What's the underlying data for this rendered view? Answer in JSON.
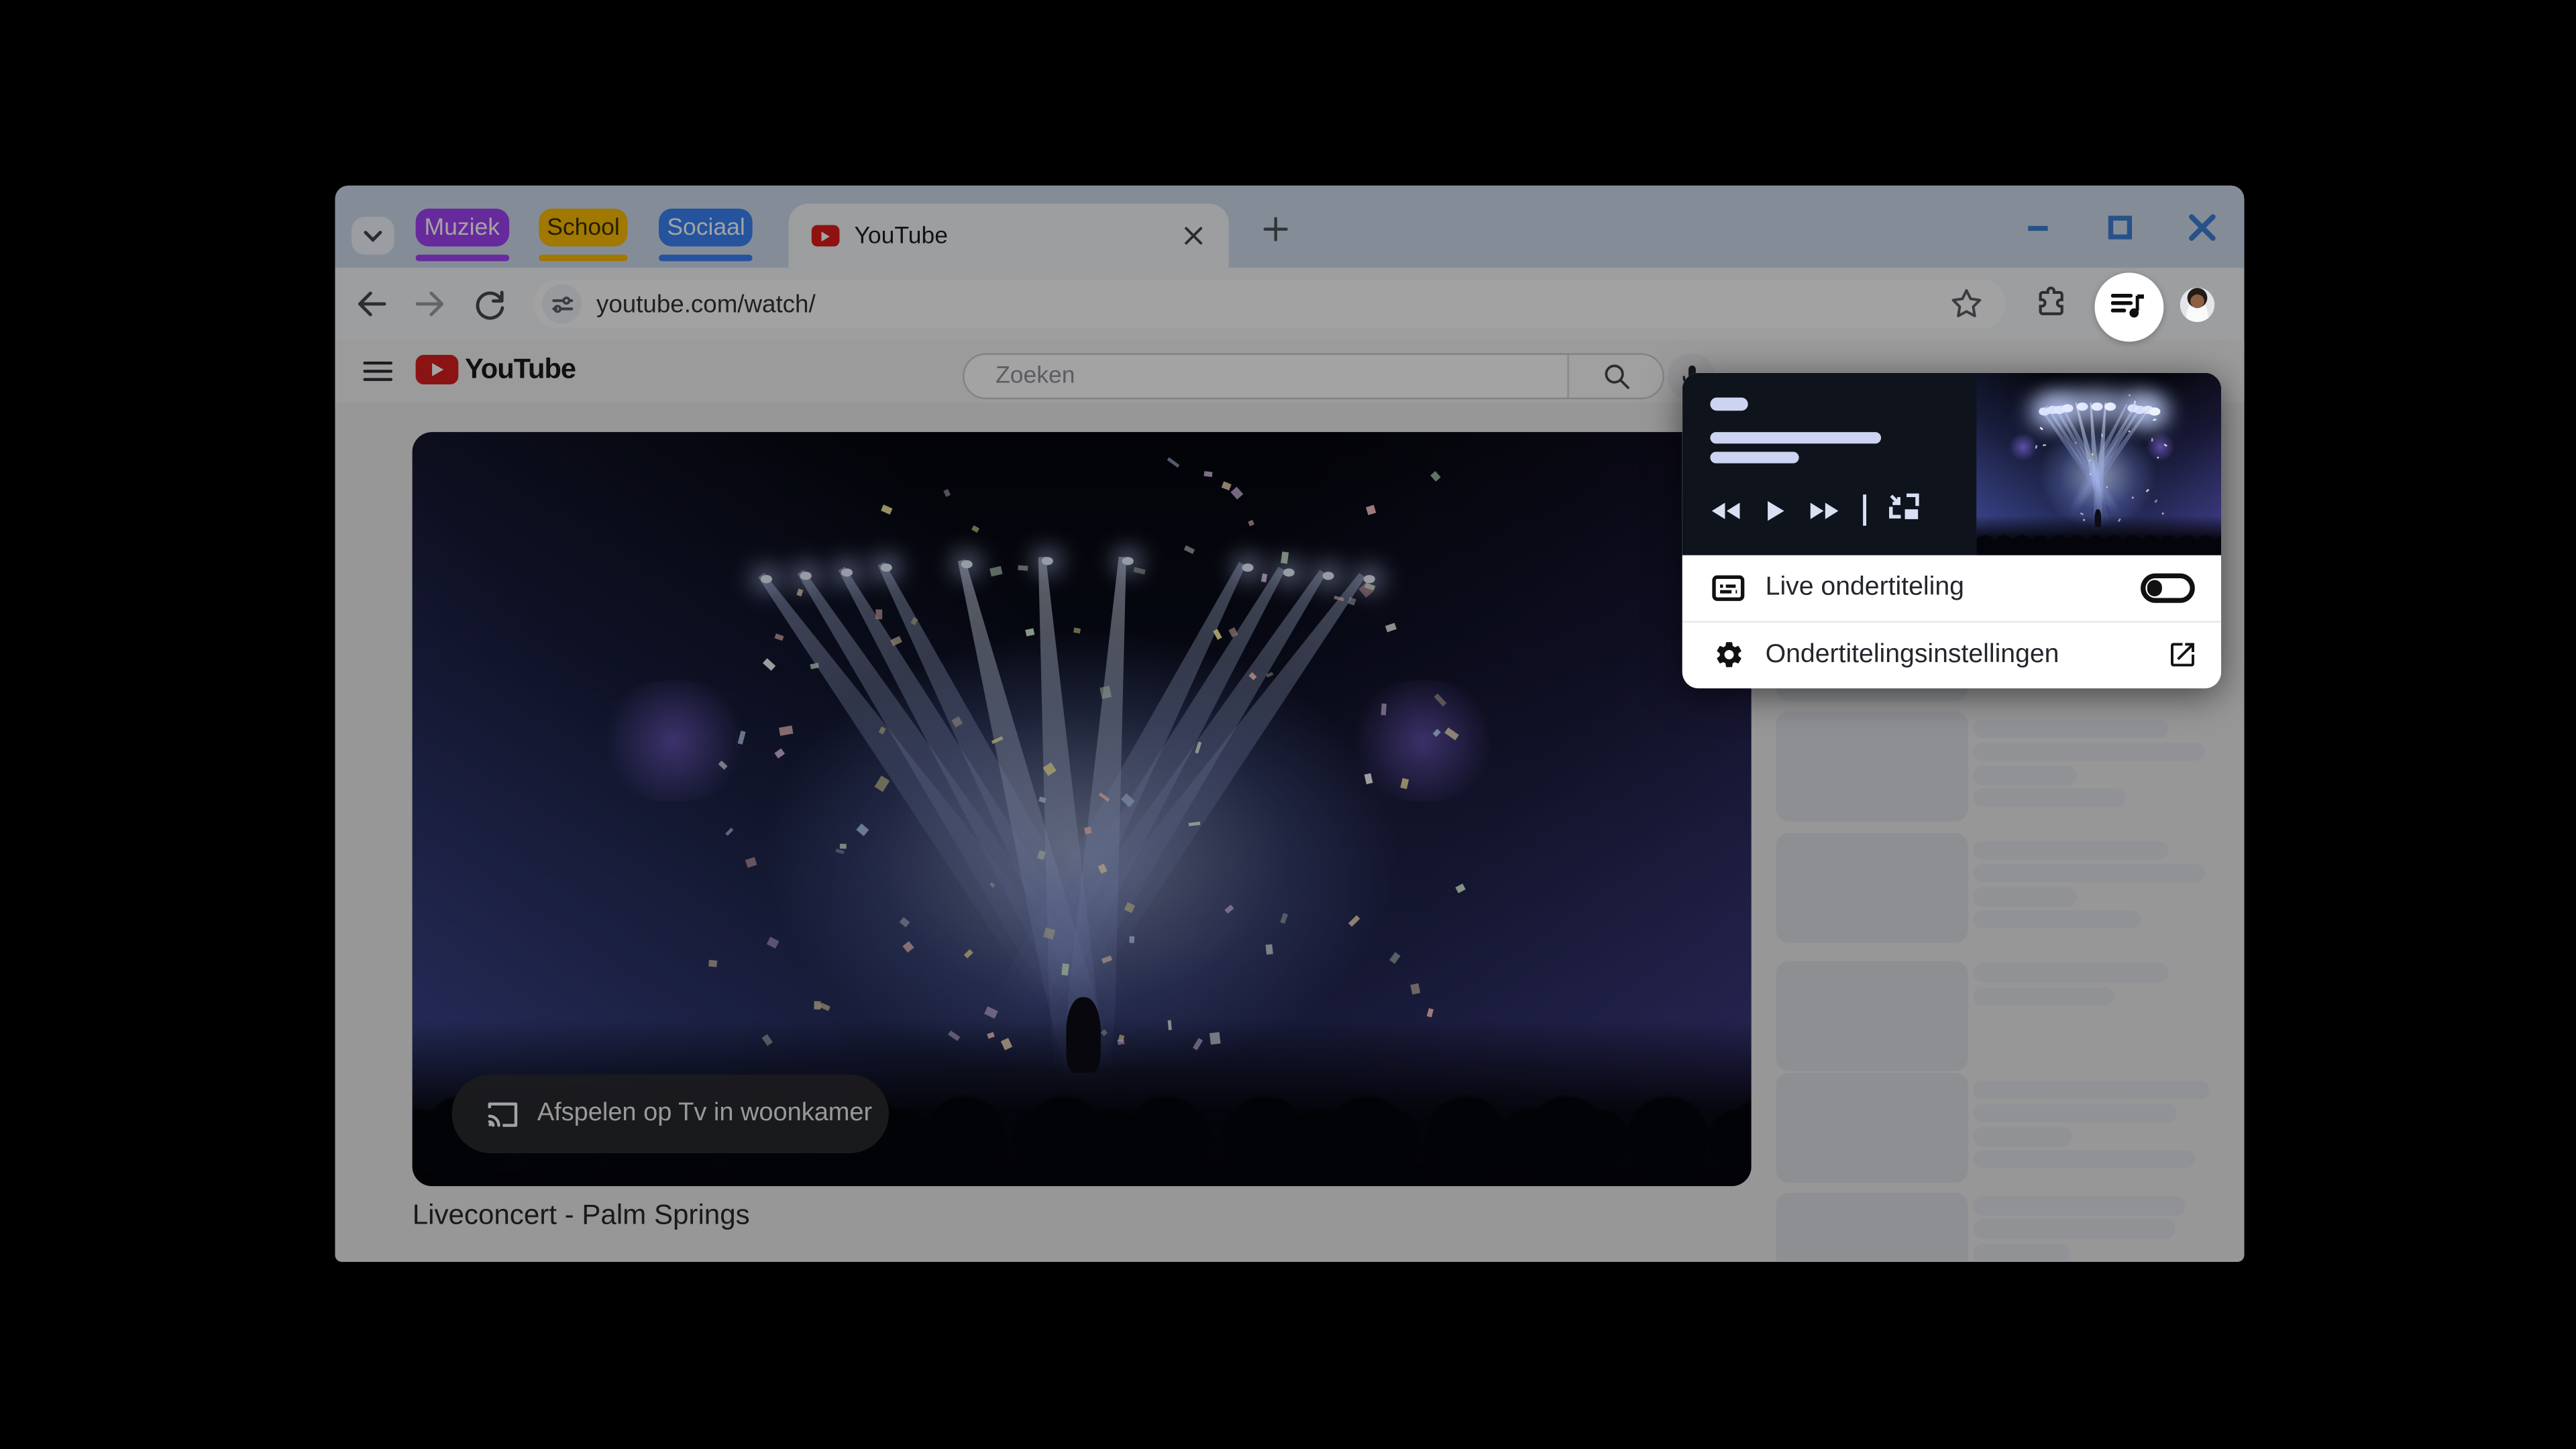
{
  "browser": {
    "tab_strip": {
      "search_button": "tab-search-chevron",
      "groups": [
        {
          "label": "Muziek",
          "color": "#a142f4",
          "text_color": "#ffffff"
        },
        {
          "label": "School",
          "color": "#fbbc04",
          "text_color": "#3c2f00"
        },
        {
          "label": "Sociaal",
          "color": "#3b82f6",
          "text_color": "#ffffff"
        }
      ],
      "active_tab": {
        "title": "YouTube"
      }
    },
    "toolbar": {
      "url": "youtube.com/watch/"
    },
    "window_controls_color": "#3f7fd6"
  },
  "youtube": {
    "search_placeholder": "Zoeken",
    "player": {
      "cast_overlay_label": "Afspelen op Tv in woonkamer"
    },
    "video_title": "Liveconcert - Palm Springs"
  },
  "media_popup": {
    "rows": [
      {
        "label": "Live ondertiteling",
        "control": "toggle",
        "state": "off"
      },
      {
        "label": "Ondertitelingsinstellingen",
        "control": "open-in-new"
      }
    ],
    "colors": {
      "background": "#0f131c",
      "skeleton": "#ccd4f2"
    }
  },
  "icons": {
    "media_button": "queue-music-icon",
    "playback": [
      "rewind-icon",
      "play-icon",
      "fast-forward-icon",
      "picture-in-picture-icon"
    ],
    "row_icons": [
      "live-caption-icon",
      "gear-icon",
      "open-in-new-icon"
    ],
    "player_overlay": "cast-icon"
  }
}
